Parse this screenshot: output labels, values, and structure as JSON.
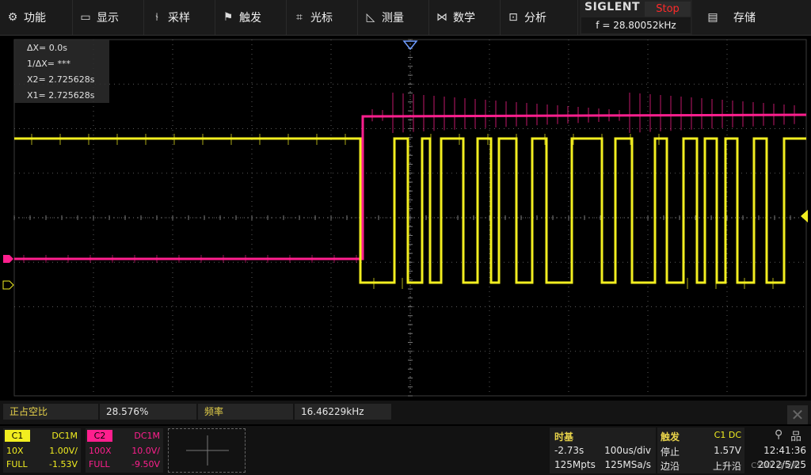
{
  "menu": [
    {
      "label": "功能",
      "icon": "gear-icon",
      "glyph": "⚙"
    },
    {
      "label": "显示",
      "icon": "monitor-icon",
      "glyph": "▭"
    },
    {
      "label": "采样",
      "icon": "acquire-icon",
      "glyph": "⫮"
    },
    {
      "label": "触发",
      "icon": "flag-icon",
      "glyph": "⚑"
    },
    {
      "label": "光标",
      "icon": "cursor-cross-icon",
      "glyph": "⌗"
    },
    {
      "label": "测量",
      "icon": "ruler-icon",
      "glyph": "◺"
    },
    {
      "label": "数学",
      "icon": "math-icon",
      "glyph": "⋈"
    },
    {
      "label": "分析",
      "icon": "analysis-icon",
      "glyph": "⊡"
    }
  ],
  "brand": {
    "name": "SIGLENT",
    "run_state": "Stop",
    "frequency": "f = 28.80052kHz"
  },
  "save": {
    "label": "存储",
    "glyph": "▤"
  },
  "cursors": {
    "dx": "ΔX= 0.0s",
    "inv_dx": "1/ΔX= ***",
    "x2": "X2= 2.725628s",
    "x1": "X1= 2.725628s"
  },
  "measurements": [
    {
      "label": "正占空比",
      "value": "28.576%"
    },
    {
      "label": "频率",
      "value": "16.46229kHz"
    }
  ],
  "channels": [
    {
      "name": "C1",
      "coupling": "DC1M",
      "probe": "10X",
      "scale": "1.00V/",
      "bw": "FULL",
      "offset": "-1.53V",
      "color": "#f2ee20"
    },
    {
      "name": "C2",
      "coupling": "DC1M",
      "probe": "100X",
      "scale": "10.0V/",
      "bw": "FULL",
      "offset": "-9.50V",
      "color": "#ff1f8e"
    }
  ],
  "timebase": {
    "title": "时基",
    "delay": "-2.73s",
    "scale": "100us/div",
    "memory": "125Mpts",
    "sample_rate": "125MSa/s"
  },
  "trigger": {
    "title": "触发",
    "source": "C1 DC",
    "mode": "停止",
    "level": "1.57V",
    "type": "边沿",
    "slope": "上升沿"
  },
  "status": {
    "time": "12:41:36",
    "date": "2022/5/25",
    "watermark": "CSDN @记船"
  },
  "colors": {
    "ch1": "#f2ee20",
    "ch2": "#ff1f8e",
    "grid": "#5a5a5a",
    "stop": "#ff2a2a"
  }
}
